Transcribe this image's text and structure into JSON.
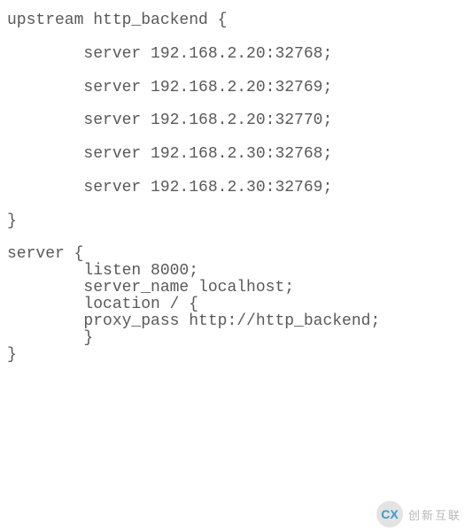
{
  "code": {
    "upstream_open": "upstream http_backend {",
    "server_lines": [
      "        server 192.168.2.20:32768;",
      "        server 192.168.2.20:32769;",
      "        server 192.168.2.20:32770;",
      "        server 192.168.2.30:32768;",
      "        server 192.168.2.30:32769;"
    ],
    "upstream_close": "}",
    "server_open": "server {",
    "listen": "        listen 8000;",
    "server_name": "        server_name localhost;",
    "location": "        location / {",
    "proxy_pass": "        proxy_pass http://http_backend;",
    "location_close": "        }",
    "server_close": "}"
  },
  "watermark": {
    "logo_text": "CX",
    "brand": "创新互联"
  }
}
